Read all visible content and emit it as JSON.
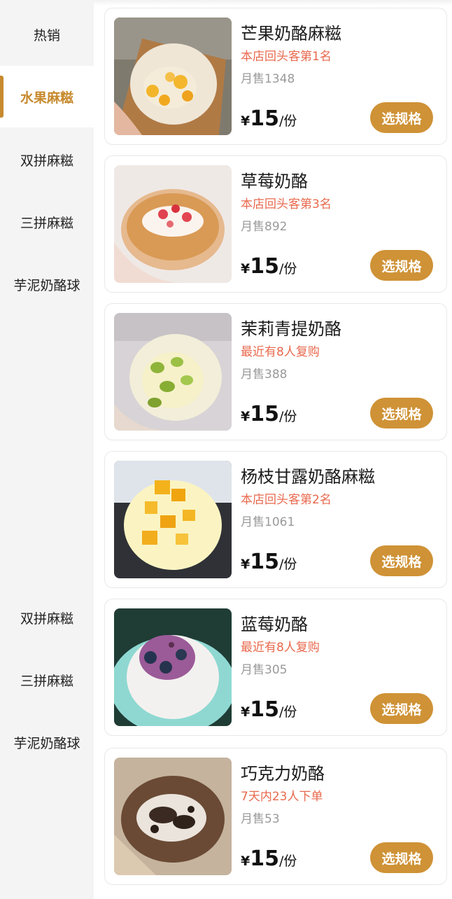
{
  "sidebar": {
    "items": [
      {
        "label": "热销"
      },
      {
        "label": "水果麻糍"
      },
      {
        "label": "双拼麻糍"
      },
      {
        "label": "三拼麻糍"
      },
      {
        "label": "芋泥奶酪球"
      },
      {
        "label": "双拼麻糍"
      },
      {
        "label": "三拼麻糍"
      },
      {
        "label": "芋泥奶酪球"
      }
    ],
    "active_index": 1,
    "accent_color": "#c78a2e"
  },
  "products": [
    {
      "name": "芒果奶酪麻糍",
      "tag": "本店回头客第1名",
      "sales": "月售1348",
      "currency": "¥",
      "price": "15",
      "unit": "/份",
      "button": "选规格",
      "image": "mango-cheese-mochi"
    },
    {
      "name": "草莓奶酪",
      "tag": "本店回头客第3名",
      "sales": "月售892",
      "currency": "¥",
      "price": "15",
      "unit": "/份",
      "button": "选规格",
      "image": "strawberry-cheese"
    },
    {
      "name": "茉莉青提奶酪",
      "tag": "最近有8人复购",
      "sales": "月售388",
      "currency": "¥",
      "price": "15",
      "unit": "/份",
      "button": "选规格",
      "image": "jasmine-grape-cheese"
    },
    {
      "name": "杨枝甘露奶酪麻糍",
      "tag": "本店回头客第2名",
      "sales": "月售1061",
      "currency": "¥",
      "price": "15",
      "unit": "/份",
      "button": "选规格",
      "image": "mango-pomelo-cheese-mochi"
    },
    {
      "name": "蓝莓奶酪",
      "tag": "最近有8人复购",
      "sales": "月售305",
      "currency": "¥",
      "price": "15",
      "unit": "/份",
      "button": "选规格",
      "image": "blueberry-cheese"
    },
    {
      "name": "巧克力奶酪",
      "tag": "7天内23人下单",
      "sales": "月售53",
      "currency": "¥",
      "price": "15",
      "unit": "/份",
      "button": "选规格",
      "image": "chocolate-cheese"
    }
  ],
  "colors": {
    "button": "#cf9236",
    "tag": "#e8694d",
    "sales": "#9a9a9a"
  }
}
